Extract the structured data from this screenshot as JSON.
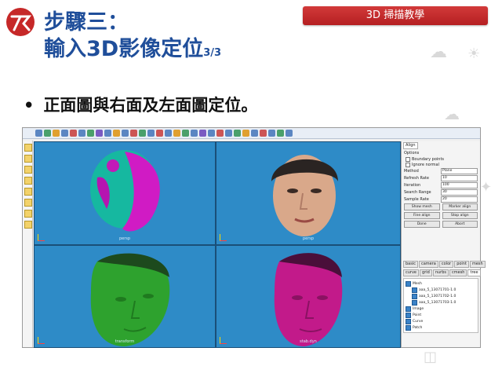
{
  "header": {
    "badge": "3D 掃描教學"
  },
  "title": {
    "line1": "步驟三：",
    "line2": "輸入3D影像定位",
    "line2_sub": "3/3"
  },
  "bullet": {
    "dot": "•",
    "text": "正面圖與右面及左面圖定位。"
  },
  "viewports": [
    {
      "label": "persp",
      "content": "mesh-overlap"
    },
    {
      "label": "persp",
      "content": "textured-face"
    },
    {
      "label": "transform",
      "content": "green-mesh"
    },
    {
      "label": "stab.dyn",
      "content": "magenta-mesh"
    }
  ],
  "align_panel": {
    "title": "Align",
    "options_label": "Options",
    "checks": [
      "Boundary points",
      "Ignore normal"
    ],
    "fields": [
      {
        "label": "Method",
        "value": "Plane"
      },
      {
        "label": "Refresh Rate",
        "value": "10"
      },
      {
        "label": "Iteration",
        "value": "100"
      },
      {
        "label": "Search Range",
        "value": "30"
      },
      {
        "label": "Sample Rate",
        "value": "20"
      }
    ],
    "buttons": [
      [
        "Show mesh",
        "Marker align"
      ],
      [
        "Fine align",
        "Stop align"
      ],
      [
        "Done",
        "Abort"
      ]
    ]
  },
  "tab_row1": [
    "basic",
    "camera",
    "color",
    "point",
    "mesh"
  ],
  "tab_row2": [
    "curve",
    "grid",
    "nurbs",
    "cmesh",
    "tree"
  ],
  "tree": {
    "mesh_label": "Mesh",
    "mesh_items": [
      "aaa_5_13071701-1.0",
      "aaa_5_13071702-1.0",
      "aaa_5_13071703-1.0"
    ],
    "others": [
      "Image",
      "Point",
      "Curve",
      "Patch"
    ]
  },
  "colors": {
    "accent": "#c62828",
    "title": "#1f4e9a",
    "viewport": "#2e8bc7"
  }
}
